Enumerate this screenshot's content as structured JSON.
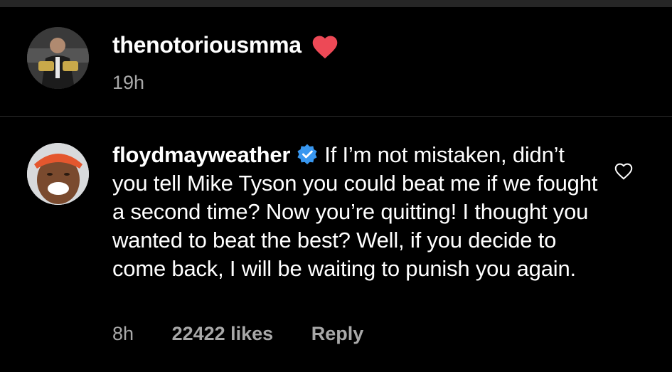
{
  "post": {
    "username": "thenotoriousmma",
    "time": "19h"
  },
  "comment": {
    "username": "floydmayweather",
    "text": "If I’m not mistaken, didn’t you tell Mike Tyson you could beat me if we fought a second time? Now you’re quitting!  I thought you wanted to beat the best?  Well, if you decide to come back, I will be waiting to punish you again.",
    "time": "8h",
    "likes": "22422 likes",
    "reply_label": "Reply"
  },
  "icons": {
    "post_heart": "heart-filled-icon",
    "verified": "verified-badge-icon",
    "comment_like": "heart-outline-icon"
  },
  "colors": {
    "background": "#000000",
    "heart_red": "#ed4956",
    "verified_blue": "#3897f0",
    "secondary_text": "#a8a8a8"
  }
}
